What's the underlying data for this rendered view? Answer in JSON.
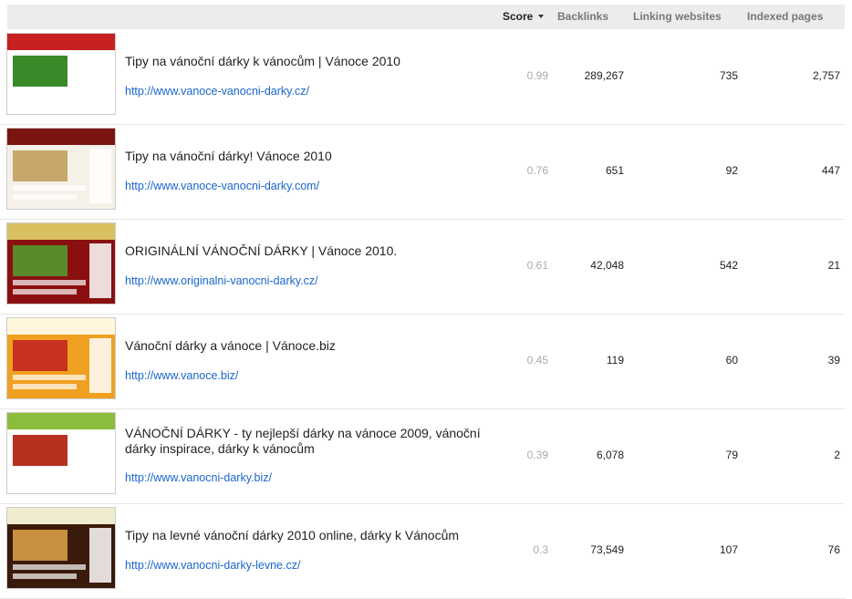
{
  "header": {
    "score_label": "Score",
    "backlinks_label": "Backlinks",
    "linking_label": "Linking websites",
    "indexed_label": "Indexed pages"
  },
  "colors": {
    "link": "#1a66cc",
    "header_bg": "#ececec",
    "score_text": "#aaaaaa"
  },
  "rows": [
    {
      "title": "Tipy na vánoční dárky k vánocům | Vánoce 2010",
      "url": "http://www.vanoce-vanocni-darky.cz/",
      "score": "0.99",
      "backlinks": "289,267",
      "linking_websites": "735",
      "indexed_pages": "2,757",
      "thumb_colors": [
        "#ffffff",
        "#c62020",
        "#3a8a2a"
      ]
    },
    {
      "title": "Tipy na vánoční dárky! Vánoce 2010",
      "url": "http://www.vanoce-vanocni-darky.com/",
      "score": "0.76",
      "backlinks": "651",
      "linking_websites": "92",
      "indexed_pages": "447",
      "thumb_colors": [
        "#f5f1e8",
        "#7a1410",
        "#c8a86a"
      ]
    },
    {
      "title": "ORIGINÁLNÍ VÁNOČNÍ DÁRKY | Vánoce 2010.",
      "url": "http://www.originalni-vanocni-darky.cz/",
      "score": "0.61",
      "backlinks": "42,048",
      "linking_websites": "542",
      "indexed_pages": "21",
      "thumb_colors": [
        "#8a1010",
        "#d9c060",
        "#5a8a2a"
      ]
    },
    {
      "title": "Vánoční dárky a vánoce | Vánoce.biz",
      "url": "http://www.vanoce.biz/",
      "score": "0.45",
      "backlinks": "119",
      "linking_websites": "60",
      "indexed_pages": "39",
      "thumb_colors": [
        "#f0a020",
        "#fff6dc",
        "#c83020"
      ]
    },
    {
      "title": "VÁNOČNÍ DÁRKY - ty nejlepší dárky na vánoce 2009, vánoční dárky inspirace, dárky k vánocům",
      "url": "http://www.vanocni-darky.biz/",
      "score": "0.39",
      "backlinks": "6,078",
      "linking_websites": "79",
      "indexed_pages": "2",
      "thumb_colors": [
        "#ffffff",
        "#8cbc3c",
        "#b83020"
      ]
    },
    {
      "title": "Tipy na levné vánoční dárky 2010 online, dárky k Vánocům",
      "url": "http://www.vanocni-darky-levne.cz/",
      "score": "0.3",
      "backlinks": "73,549",
      "linking_websites": "107",
      "indexed_pages": "76",
      "thumb_colors": [
        "#3a1a0a",
        "#f0ecd0",
        "#c89040"
      ]
    }
  ]
}
